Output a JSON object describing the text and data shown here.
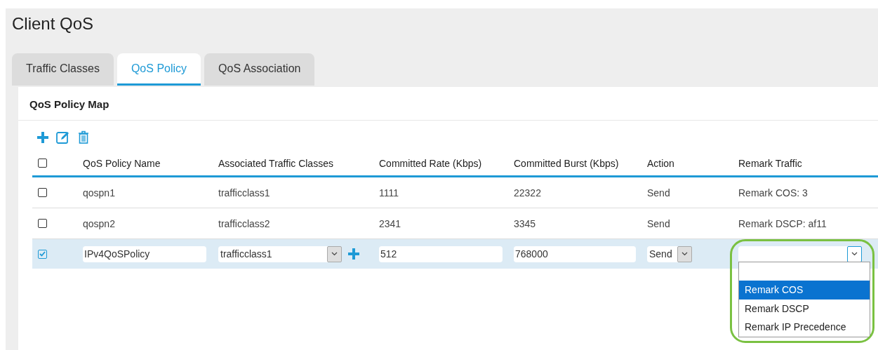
{
  "page_title": "Client QoS",
  "tabs": [
    {
      "label": "Traffic Classes",
      "selected": false
    },
    {
      "label": "QoS Policy",
      "selected": true
    },
    {
      "label": "QoS Association",
      "selected": false
    }
  ],
  "section_title": "QoS Policy Map",
  "toolbar": [
    {
      "kind": "add"
    },
    {
      "kind": "edit"
    },
    {
      "kind": "delete"
    }
  ],
  "table": {
    "select_all": {
      "checked": false
    },
    "columns": [
      "QoS Policy Name",
      "Associated Traffic Classes",
      "Committed Rate (Kbps)",
      "Committed Burst (Kbps)",
      "Action",
      "Remark Traffic"
    ],
    "rows": [
      {
        "kind": "view",
        "checked": false,
        "cells": [
          "qospn1",
          "trafficclass1",
          "1111",
          "22322",
          "Send",
          "Remark COS: 3"
        ]
      },
      {
        "kind": "view",
        "checked": false,
        "cells": [
          "qospn2",
          "trafficclass2",
          "2341",
          "3345",
          "Send",
          "Remark DSCP: af11"
        ]
      },
      {
        "kind": "edit",
        "checked": true,
        "name": "IPv4QoSPolicy",
        "traffic_class": "trafficclass1",
        "rate": "512",
        "burst": "768000",
        "action": "Send",
        "remark": {
          "open": true,
          "highlighted": true,
          "blank_option": true,
          "options": [
            {
              "label": "Remark COS",
              "selected": true
            },
            {
              "label": "Remark DSCP",
              "selected": false
            },
            {
              "label": "Remark IP Precedence",
              "selected": false
            }
          ]
        }
      }
    ]
  }
}
